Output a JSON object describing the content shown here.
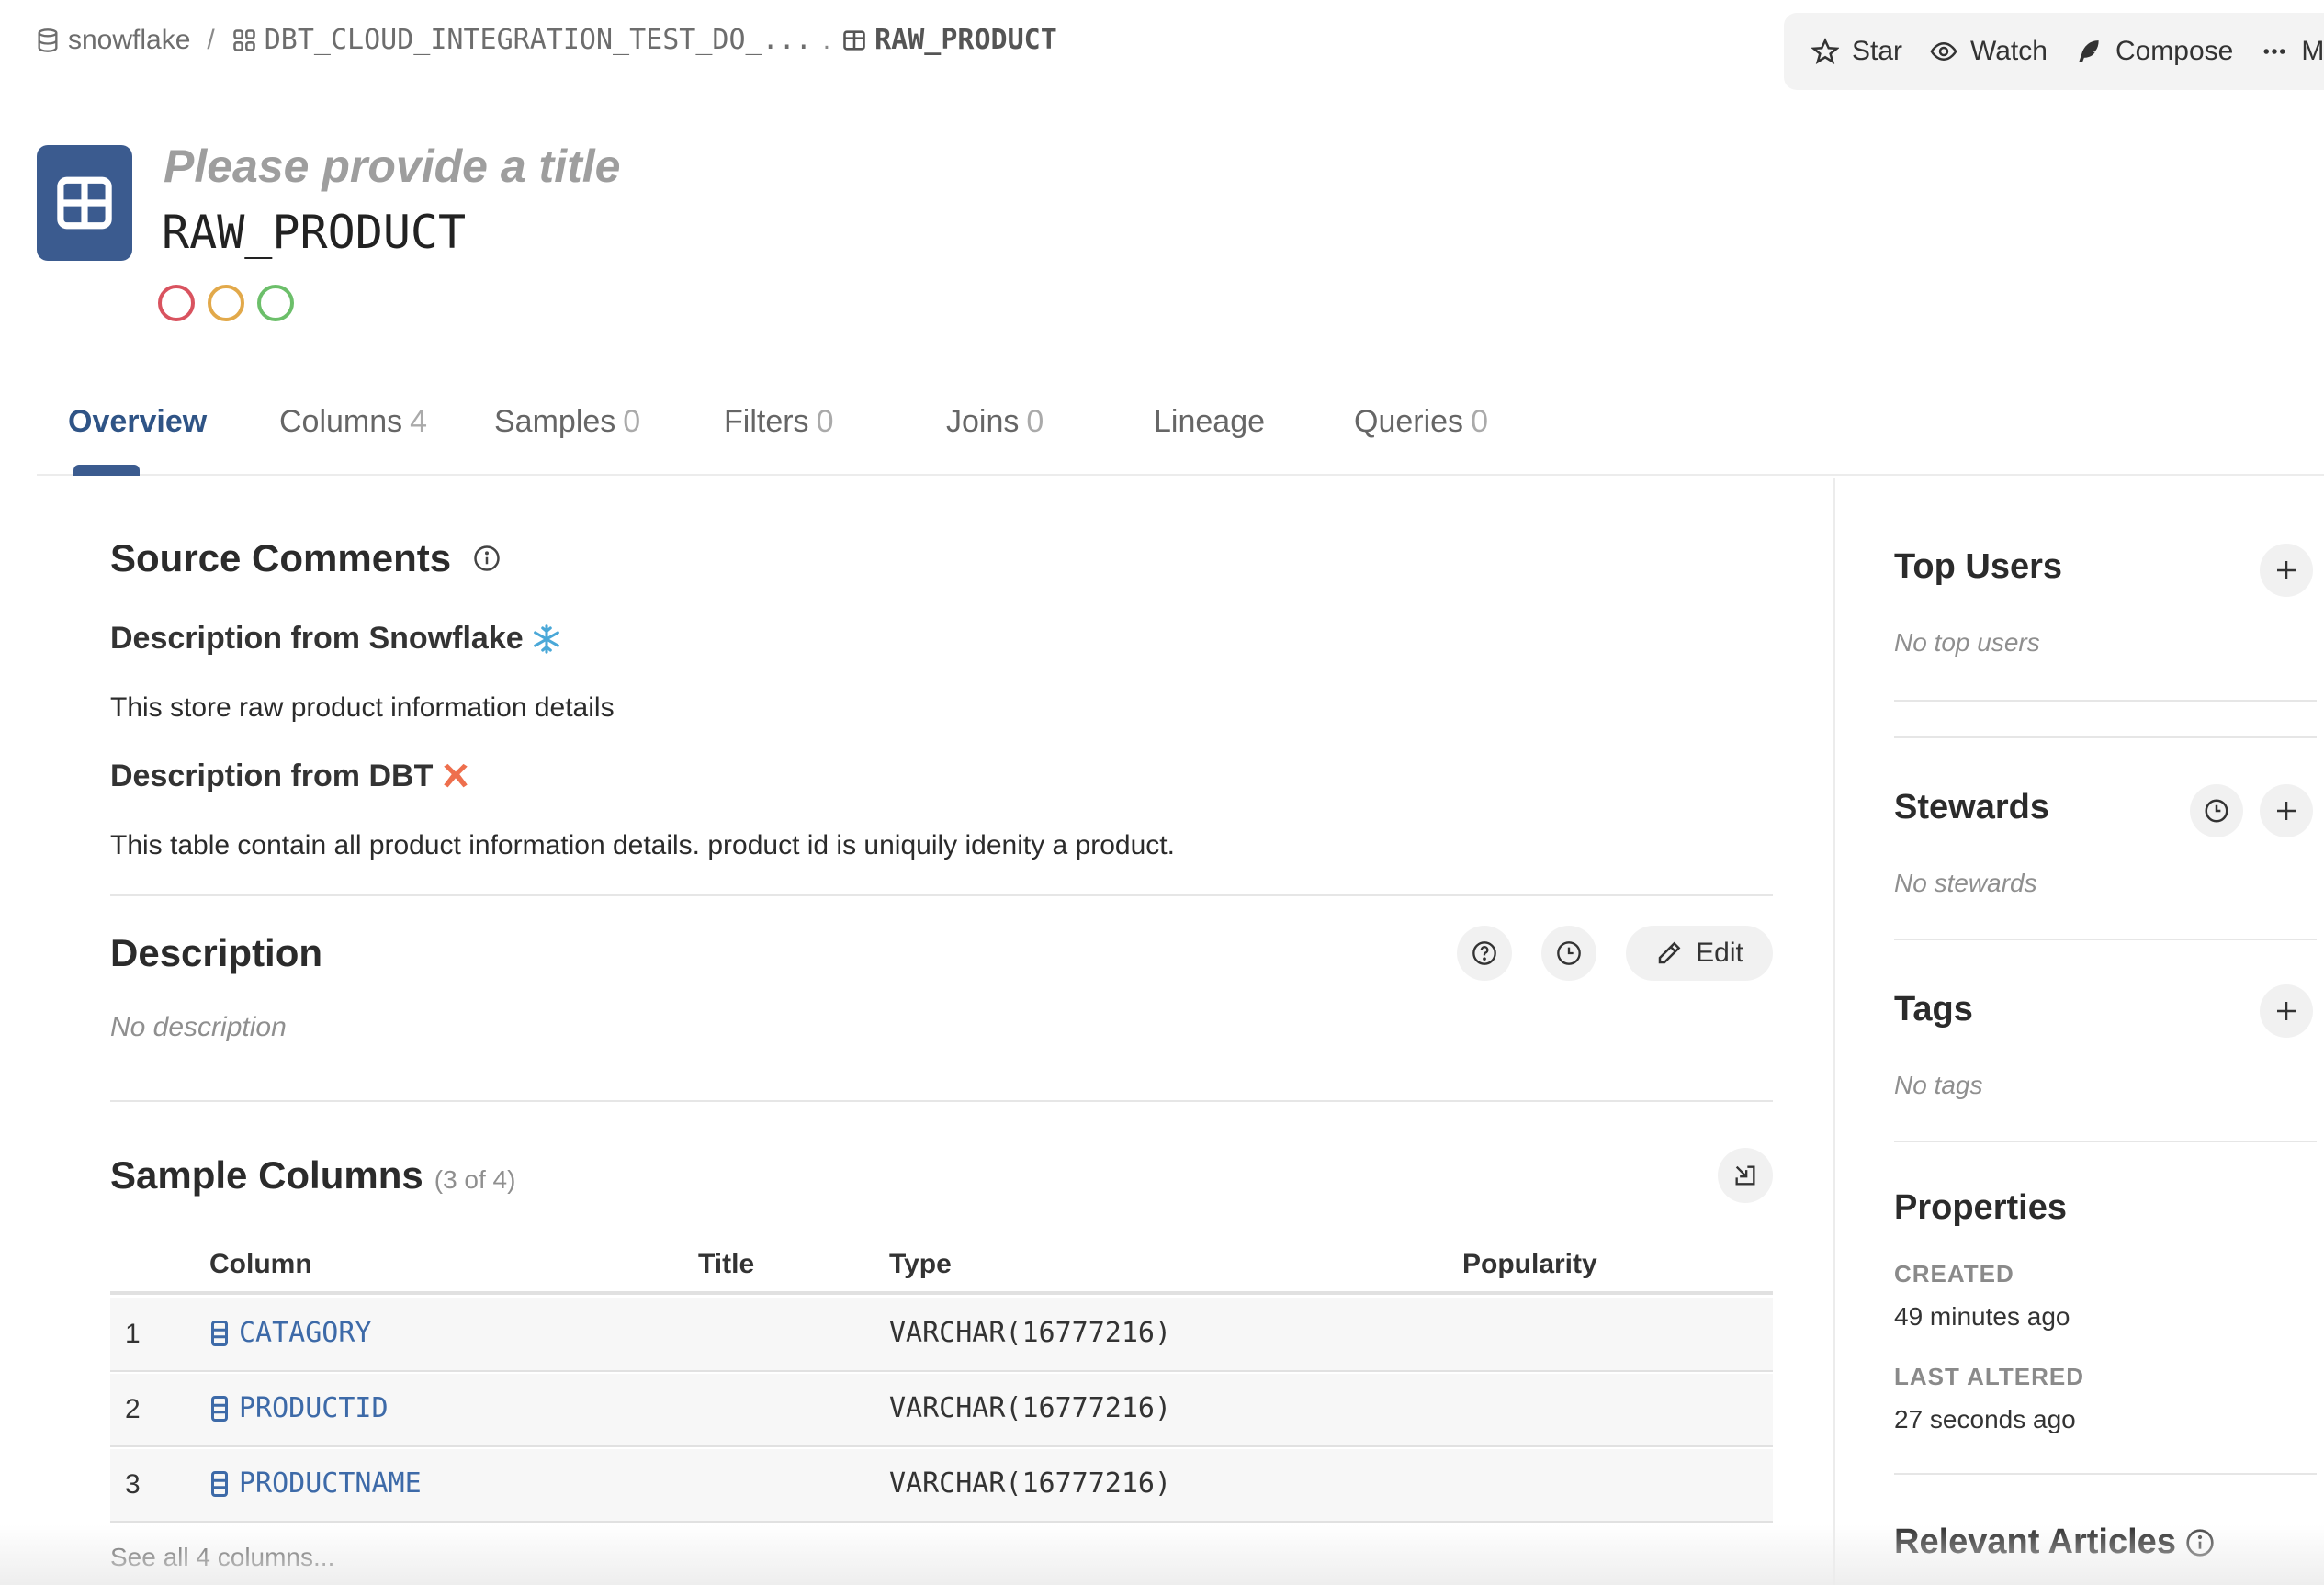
{
  "breadcrumb": {
    "source": "snowflake",
    "schema": "DBT_CLOUD_INTEGRATION_TEST_DO_...",
    "dots": ".",
    "current": "RAW_PRODUCT"
  },
  "actions": {
    "star": "Star",
    "watch": "Watch",
    "compose": "Compose",
    "more": "Mo"
  },
  "header": {
    "title_placeholder": "Please provide a title",
    "name": "RAW_PRODUCT",
    "status_colors": [
      "#d9535f",
      "#e2a94a",
      "#6cbf6a"
    ]
  },
  "tabs": [
    {
      "label": "Overview",
      "count": ""
    },
    {
      "label": "Columns",
      "count": "4"
    },
    {
      "label": "Samples",
      "count": "0"
    },
    {
      "label": "Filters",
      "count": "0"
    },
    {
      "label": "Joins",
      "count": "0"
    },
    {
      "label": "Lineage",
      "count": ""
    },
    {
      "label": "Queries",
      "count": "0"
    }
  ],
  "source_comments": {
    "title": "Source Comments",
    "snowflake_heading": "Description from Snowflake",
    "snowflake_text": "This store raw product information details",
    "dbt_heading": "Description from DBT",
    "dbt_text": "This table contain all product information details. product id is uniquily idenity a product."
  },
  "description": {
    "title": "Description",
    "empty": "No description",
    "edit_label": "Edit"
  },
  "sample_columns": {
    "title": "Sample Columns",
    "count_text": "(3 of 4)",
    "headers": {
      "column": "Column",
      "title": "Title",
      "type": "Type",
      "popularity": "Popularity"
    },
    "rows": [
      {
        "num": "1",
        "name": "CATAGORY",
        "type": "VARCHAR(16777216)"
      },
      {
        "num": "2",
        "name": "PRODUCTID",
        "type": "VARCHAR(16777216)"
      },
      {
        "num": "3",
        "name": "PRODUCTNAME",
        "type": "VARCHAR(16777216)"
      }
    ],
    "see_all": "See all 4 columns..."
  },
  "sidebar": {
    "top_users": {
      "title": "Top Users",
      "empty": "No top users"
    },
    "stewards": {
      "title": "Stewards",
      "empty": "No stewards"
    },
    "tags": {
      "title": "Tags",
      "empty": "No tags"
    },
    "properties": {
      "title": "Properties",
      "created_label": "CREATED",
      "created_value": "49 minutes ago",
      "altered_label": "LAST ALTERED",
      "altered_value": "27 seconds ago"
    },
    "relevant_articles": {
      "title": "Relevant Articles"
    }
  },
  "colors": {
    "accent": "#3b5b8f",
    "link": "#3d6aa8",
    "snowflake": "#4aa8d8",
    "dbt": "#ee6f4d"
  }
}
